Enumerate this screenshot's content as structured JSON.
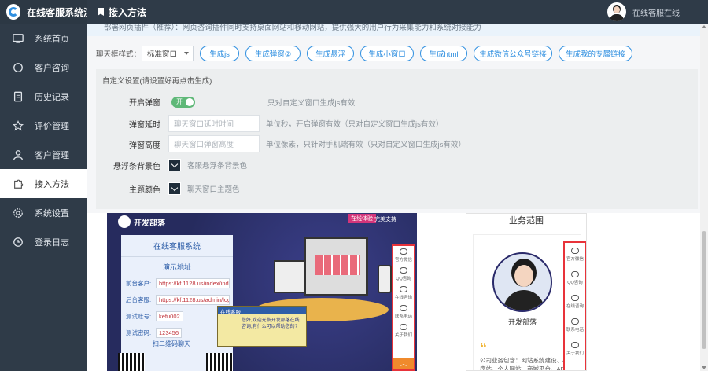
{
  "app": {
    "title": "在线客服系统演"
  },
  "topbar": {
    "title": "接入方法",
    "user_name": "在线客服在线"
  },
  "sidebar": {
    "items": [
      {
        "label": "系统首页",
        "icon": "monitor-icon"
      },
      {
        "label": "客户咨询",
        "icon": "chat-circle-icon"
      },
      {
        "label": "历史记录",
        "icon": "document-icon"
      },
      {
        "label": "评价管理",
        "icon": "star-icon"
      },
      {
        "label": "客户管理",
        "icon": "user-icon"
      },
      {
        "label": "接入方法",
        "icon": "puzzle-icon"
      },
      {
        "label": "系统设置",
        "icon": "gear-icon"
      },
      {
        "label": "登录日志",
        "icon": "clock-icon"
      }
    ],
    "active_index": 5
  },
  "intro": "部署网页插件（推荐）：网页咨询插件同时支持桌面网站和移动网站，提供强大的用户行为采集能力和系统对接能力",
  "style_row": {
    "label": "聊天框样式：",
    "select_value": "标准窗口",
    "buttons": [
      "生成js",
      "生成弹窗②",
      "生成悬浮",
      "生成小窗口",
      "生成html",
      "生成微信公众号链接",
      "生成我的专属链接"
    ]
  },
  "custom": {
    "title": "自定义设置(请设置好再点击生成)",
    "popup": {
      "label": "开启弹窗",
      "toggle_text": "开",
      "hint": "只对自定义窗口生成js有效"
    },
    "delay": {
      "label": "弹窗延时",
      "placeholder": "聊天窗口延时时间",
      "hint": "单位秒，开启弹窗有效（只对自定义窗口生成js有效）"
    },
    "height": {
      "label": "弹窗高度",
      "placeholder": "聊天窗口弹窗高度",
      "hint": "单位像素，只针对手机端有效（只对自定义窗口生成js有效）"
    },
    "float_bg": {
      "label": "悬浮条背景色",
      "hint": "客服悬浮条背景色"
    },
    "theme": {
      "label": "主题颜色",
      "hint": "聊天窗口主题色"
    }
  },
  "preview_desktop": {
    "logo": "开发部落",
    "tag": "在线体验",
    "tag2": "完美支持",
    "card_title": "在线客服系统",
    "card_sub": "演示地址",
    "rows": [
      {
        "k": "前台客户:",
        "v": "https://kf.1128.us/index/inde"
      },
      {
        "k": "后台客服:",
        "v": "https://kf.1128.us/admin/logi"
      },
      {
        "k": "测试账号:",
        "v": "kefu002"
      },
      {
        "k": "测试密码:",
        "v": "123456"
      }
    ],
    "qr_label": "扫二维码聊天",
    "chat_head": "在线客服",
    "chat_body": "您好,欢迎光临开发部落在线咨询,有什么可以帮助您的?",
    "float_items": [
      "官方微信",
      "QQ咨询",
      "在线咨询",
      "联系电话",
      "关于我们"
    ]
  },
  "preview_mobile": {
    "title": "业务范围",
    "name": "开发部落",
    "text": "公司业务包含：网站系统建设、小程序站、个人网站、商城平台、APP",
    "float_items": [
      "官方微信",
      "QQ咨询",
      "在线咨询",
      "联系电话",
      "关于我们"
    ]
  }
}
